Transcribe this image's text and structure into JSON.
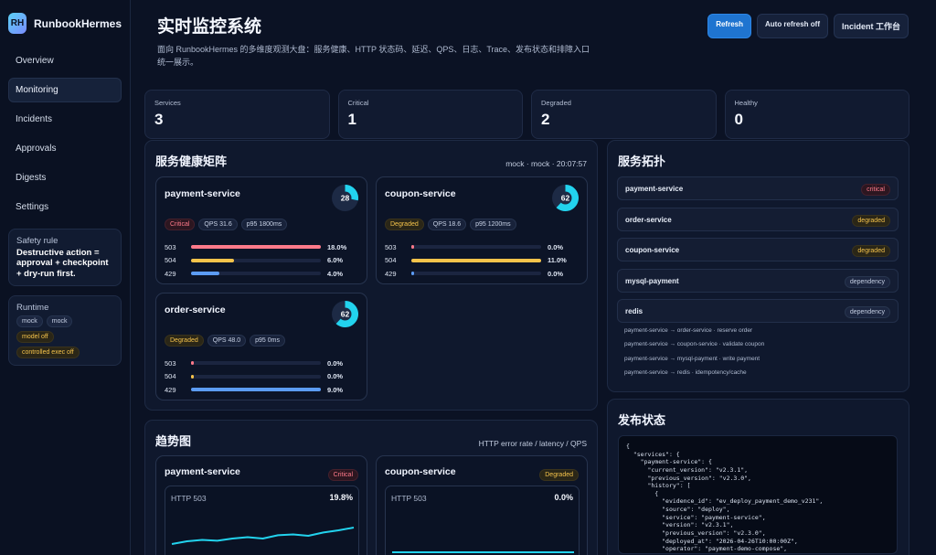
{
  "brand": {
    "logo": "RH",
    "name": "RunbookHermes"
  },
  "nav": [
    {
      "label": "Overview",
      "active": false
    },
    {
      "label": "Monitoring",
      "active": true
    },
    {
      "label": "Incidents",
      "active": false
    },
    {
      "label": "Approvals",
      "active": false
    },
    {
      "label": "Digests",
      "active": false
    },
    {
      "label": "Settings",
      "active": false
    }
  ],
  "safety": {
    "label": "Safety rule",
    "text": "Destructive action = approval + checkpoint + dry-run first."
  },
  "runtime": {
    "label": "Runtime",
    "chips": [
      "mock",
      "mock",
      "model off",
      "controlled exec off"
    ]
  },
  "header": {
    "title": "实时监控系统",
    "desc": "面向 RunbookHermes 的多维度观测大盘：服务健康、HTTP 状态码、延迟、QPS、日志、Trace、发布状态和排障入口统一展示。",
    "refresh": "Refresh",
    "auto_refresh": "Auto refresh off",
    "incident": "Incident 工作台"
  },
  "stats": [
    {
      "label": "Services",
      "value": "3"
    },
    {
      "label": "Critical",
      "value": "1"
    },
    {
      "label": "Degraded",
      "value": "2"
    },
    {
      "label": "Healthy",
      "value": "0"
    }
  ],
  "health": {
    "title": "服务健康矩阵",
    "meta": "mock · mock · 20:07:57",
    "services": [
      {
        "name": "payment-service",
        "score": "28",
        "score_frac": 0.28,
        "status": "Critical",
        "qps": "QPS 31.6",
        "p95": "p95 1800ms",
        "bars": [
          {
            "code": "503",
            "value": "18.0%",
            "frac": 1.0,
            "color": "#ff7a8a"
          },
          {
            "code": "504",
            "value": "6.0%",
            "frac": 0.33,
            "color": "#f5c34b"
          },
          {
            "code": "429",
            "value": "4.0%",
            "frac": 0.22,
            "color": "#5c9cf5"
          }
        ]
      },
      {
        "name": "coupon-service",
        "score": "62",
        "score_frac": 0.62,
        "status": "Degraded",
        "qps": "QPS 18.6",
        "p95": "p95 1200ms",
        "bars": [
          {
            "code": "503",
            "value": "0.0%",
            "frac": 0.02,
            "color": "#ff7a8a"
          },
          {
            "code": "504",
            "value": "11.0%",
            "frac": 1.0,
            "color": "#f5c34b"
          },
          {
            "code": "429",
            "value": "0.0%",
            "frac": 0.02,
            "color": "#5c9cf5"
          }
        ]
      },
      {
        "name": "order-service",
        "score": "62",
        "score_frac": 0.62,
        "status": "Degraded",
        "qps": "QPS 48.0",
        "p95": "p95 0ms",
        "bars": [
          {
            "code": "503",
            "value": "0.0%",
            "frac": 0.02,
            "color": "#ff7a8a"
          },
          {
            "code": "504",
            "value": "0.0%",
            "frac": 0.02,
            "color": "#f5c34b"
          },
          {
            "code": "429",
            "value": "9.0%",
            "frac": 1.0,
            "color": "#5c9cf5"
          }
        ]
      }
    ]
  },
  "topology": {
    "title": "服务拓扑",
    "nodes": [
      {
        "name": "payment-service",
        "badge": "critical",
        "kind": "crit"
      },
      {
        "name": "order-service",
        "badge": "degraded",
        "kind": "deg"
      },
      {
        "name": "coupon-service",
        "badge": "degraded",
        "kind": "deg"
      },
      {
        "name": "mysql-payment",
        "badge": "dependency",
        "kind": "dep"
      },
      {
        "name": "redis",
        "badge": "dependency",
        "kind": "dep"
      }
    ],
    "edges": [
      "payment-service → order-service · reserve order",
      "payment-service → coupon-service · validate coupon",
      "payment-service → mysql-payment · write payment",
      "payment-service → redis · idempotency/cache"
    ]
  },
  "trends": {
    "title": "趋势图",
    "meta": "HTTP error rate / latency / QPS",
    "cards": [
      {
        "name": "payment-service",
        "badge": "Critical",
        "metric": "HTTP 503",
        "value": "19.8%",
        "points": [
          0.3,
          0.4,
          0.45,
          0.42,
          0.5,
          0.55,
          0.5,
          0.62,
          0.65,
          0.6,
          0.72,
          0.8,
          0.9
        ]
      },
      {
        "name": "coupon-service",
        "badge": "Degraded",
        "metric": "HTTP 503",
        "value": "0.0%",
        "points": [
          0.0,
          0.0,
          0.0,
          0.0,
          0.0,
          0.0,
          0.0,
          0.0,
          0.0,
          0.0,
          0.0,
          0.0,
          0.0
        ]
      }
    ]
  },
  "release": {
    "title": "发布状态",
    "json": "{\n  \"services\": {\n    \"payment-service\": {\n      \"current_version\": \"v2.3.1\",\n      \"previous_version\": \"v2.3.0\",\n      \"history\": [\n        {\n          \"evidence_id\": \"ev_deploy_payment_demo_v231\",\n          \"source\": \"deploy\",\n          \"service\": \"payment-service\",\n          \"version\": \"v2.3.1\",\n          \"previous_version\": \"v2.3.0\",\n          \"deployed_at\": \"2026-04-26T10:00:00Z\",\n          \"operator\": \"payment-demo-compose\",\n          \"scope\": \"demo\","
  },
  "colors": {
    "accent": "#1f74d0",
    "cyan": "#22d3ee",
    "critical": "#ff7a8a",
    "degraded": "#f5c34b"
  }
}
